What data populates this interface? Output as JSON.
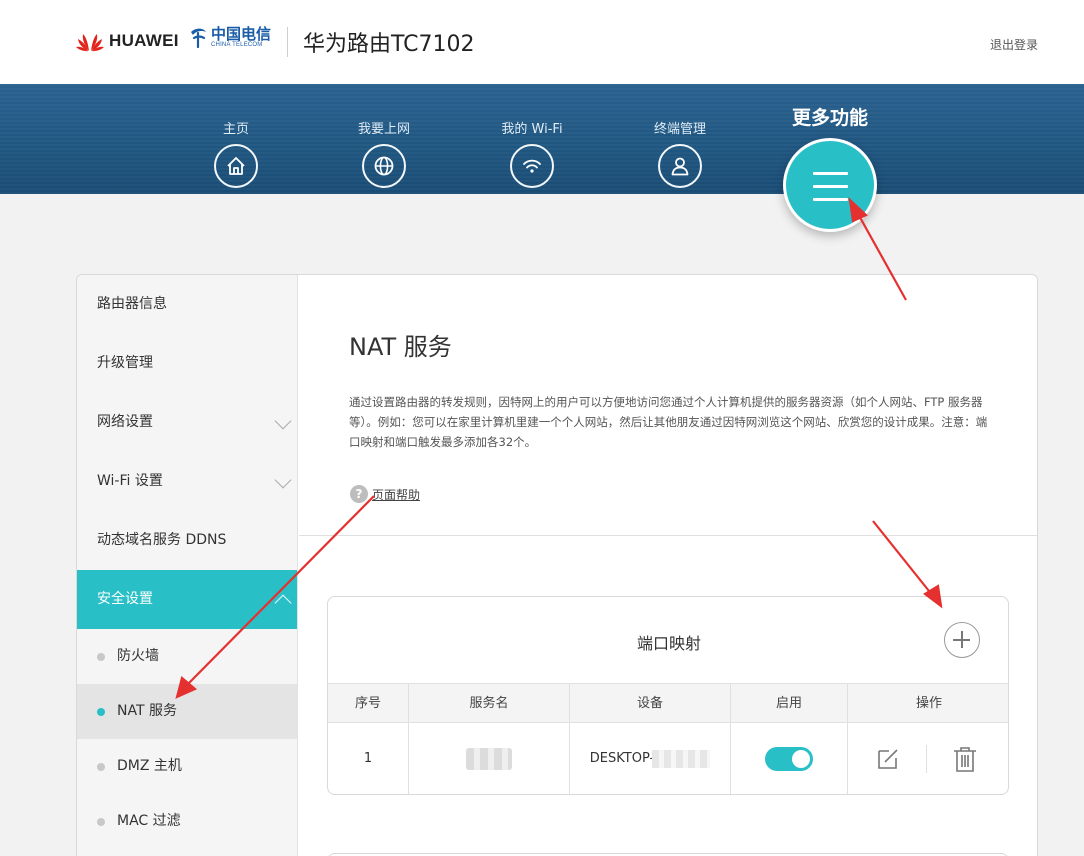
{
  "header": {
    "brand": "HUAWEI",
    "partner_cn": "中国电信",
    "partner_en": "CHINA TELECOM",
    "router_title": "华为路由TC7102",
    "logout": "退出登录"
  },
  "nav": {
    "items": [
      {
        "label": "主页",
        "icon": "home-icon"
      },
      {
        "label": "我要上网",
        "icon": "globe-icon"
      },
      {
        "label": "我的 Wi-Fi",
        "icon": "wifi-icon"
      },
      {
        "label": "终端管理",
        "icon": "user-icon"
      }
    ],
    "more_label": "更多功能",
    "more_icon": "menu-icon"
  },
  "sidebar": {
    "items": [
      {
        "label": "路由器信息"
      },
      {
        "label": "升级管理"
      },
      {
        "label": "网络设置"
      },
      {
        "label": "Wi-Fi 设置"
      },
      {
        "label": "动态域名服务 DDNS"
      },
      {
        "label": "安全设置"
      }
    ],
    "sub_items": [
      {
        "label": "防火墙"
      },
      {
        "label": "NAT 服务"
      },
      {
        "label": "DMZ 主机"
      },
      {
        "label": "MAC 过滤"
      }
    ],
    "active_item": "安全设置",
    "active_sub_item": "NAT 服务"
  },
  "main": {
    "title": "NAT 服务",
    "description": "通过设置路由器的转发规则，因特网上的用户可以方便地访问您通过个人计算机提供的服务器资源（如个人网站、FTP 服务器等）。例如：您可以在家里计算机里建一个个人网站，然后让其他朋友通过因特网浏览这个网站、欣赏您的设计成果。注意：端口映射和端口触发最多添加各32个。",
    "help_label": "页面帮助"
  },
  "port_mapping": {
    "title": "端口映射",
    "columns": [
      "序号",
      "服务名",
      "设备",
      "启用",
      "操作"
    ],
    "rows": [
      {
        "index": "1",
        "service_name": "",
        "device": "DESKTOP-",
        "enabled": true
      }
    ]
  },
  "colors": {
    "accent": "#29bfc6",
    "nav_bg": "#1f5781",
    "annotation_arrow": "#e53030"
  }
}
